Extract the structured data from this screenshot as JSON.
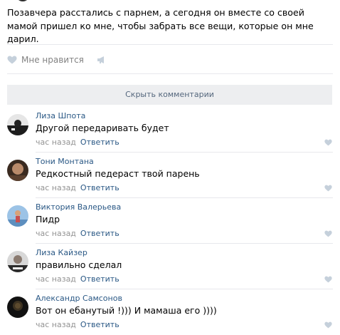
{
  "post": {
    "text": "Позавчера расстались с парнем, а сегодня он вместе со своей мамой пришел ко мне, чтобы забрать все вещи, которые он мне дарил.",
    "like_label": "Мне нравится",
    "like_icon": "heart-icon",
    "share_icon": "megaphone-icon"
  },
  "comments_toggle": {
    "label": "Скрыть комментарии"
  },
  "comments": [
    {
      "author": "Лиза Шпота",
      "text": "Другой передаривать будет",
      "time": "час назад",
      "reply": "Ответить"
    },
    {
      "author": "Тони Монтана",
      "text": "Редкостный педераст твой парень",
      "time": "час назад",
      "reply": "Ответить"
    },
    {
      "author": "Виктория Валерьева",
      "text": "Пидр",
      "time": "час назад",
      "reply": "Ответить"
    },
    {
      "author": "Лиза Кайзер",
      "text": "правильно сделал",
      "time": "час назад",
      "reply": "Ответить"
    },
    {
      "author": "Александр Самсонов",
      "text": "Вот он ебанутый !))) И мамаша его ))))",
      "time": "час назад",
      "reply": "Ответить"
    }
  ],
  "colors": {
    "link": "#2a5885",
    "muted": "#939393",
    "toggle_bg": "#edeef0",
    "divider": "#e7e8ec"
  }
}
